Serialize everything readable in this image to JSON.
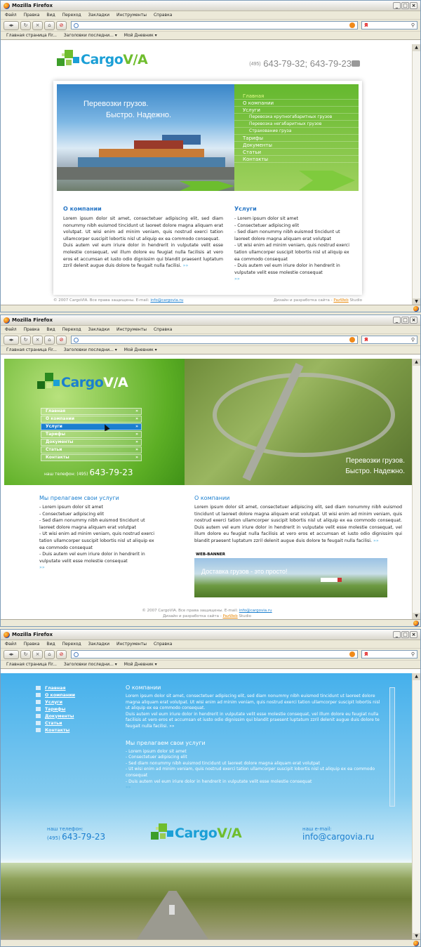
{
  "browser": {
    "title": "Mozilla Firefox",
    "menu": [
      "Файл",
      "Правка",
      "Вид",
      "Переход",
      "Закладки",
      "Инструменты",
      "Справка"
    ],
    "bookmarks": [
      "Главная страница Fir...",
      "Заголовки последни... ▾",
      "Мой Дневник ▾"
    ],
    "search_engine": "Я"
  },
  "brand": {
    "cargo": "Cargo",
    "via": "V/A"
  },
  "page1": {
    "phone_code": "(495)",
    "phone_numbers": "643-79-32; 643-79-23",
    "hero_line1": "Перевозки грузов.",
    "hero_line2": "Быстро. Надежно.",
    "menu": [
      {
        "label": "Главная",
        "type": "main",
        "active": true
      },
      {
        "label": "О компании",
        "type": "main"
      },
      {
        "label": "Услуги",
        "type": "main"
      },
      {
        "label": "Перевозка крупногабаритных грузов",
        "type": "sub"
      },
      {
        "label": "Перевозка негабаритных грузов",
        "type": "sub"
      },
      {
        "label": "Страхование груза",
        "type": "sub"
      },
      {
        "label": "Тарифы",
        "type": "main"
      },
      {
        "label": "Документы",
        "type": "main"
      },
      {
        "label": "Статьи",
        "type": "main"
      },
      {
        "label": "Контакты",
        "type": "main"
      }
    ],
    "about_title": "О компании",
    "about_p1": "Lorem ipsum dolor sit amet, consectetuer adipiscing elit, sed diam nonummy nibh euismod tincidunt ut laoreet dolore magna aliquam erat volutpat. Ut wisi enim ad minim veniam, quis nostrud exerci tation ullamcorper suscipit lobortis nisl ut aliquip ex ea commodo consequat.",
    "about_p2": "Duis autem vel eum iriure dolor in hendrerit in vulputate velit esse molestie consequat, vel illum dolore eu feugiat nulla facilisis at vero eros et accumsan et iusto odio dignissim qui blandit praesent luptatum zzril delenit augue duis dolore te feugait nulla facilisi.",
    "more": "»»",
    "services_title": "Услуги",
    "services": [
      "- Lorem ipsum dolor sit amet",
      "- Consectetuer adipiscing elit",
      "- Sed diam nonummy nibh euismod tincidunt ut laoreet dolore magna aliquam erat volutpat",
      "- Ut wisi enim ad minim veniam, quis nostrud exerci tation ullamcorper suscipit lobortis nisl ut aliquip ex ea commodo consequat",
      "- Duis autem vel eum iriure dolor in hendrerit in vulputate velit esse molestie consequat"
    ],
    "footer_left": "© 2007 CargoVIA. Все права защищены. E-mail:",
    "email": "info@cargovia.ru",
    "footer_right_pre": "Дизайн и разработка сайта -",
    "studio_name": "PazWeb",
    "studio_suffix": "Studio"
  },
  "page2": {
    "menu": [
      "Главная",
      "О компании",
      "Услуги",
      "Тарифы",
      "Документы",
      "Статьи",
      "Контакты"
    ],
    "menu_arrow": "»",
    "phone_label": "наш телефон:",
    "phone_code": "(495)",
    "phone": "643-79-23",
    "hero_line1": "Перевозки грузов.",
    "hero_line2": "Быстро. Надежно.",
    "services_title": "Мы прелагаем свои услуги",
    "services": [
      "- Lorem ipsum dolor sit amet",
      "- Consectetuer adipiscing elit",
      "- Sed diam nonummy nibh euismod tincidunt ut laoreet dolore magna aliquam erat volutpat",
      "- Ut wisi enim ad minim veniam, quis nostrud exerci tation ullamcorper suscipit lobortis nisl ut aliquip ex ea commodo consequat",
      "- Duis autem vel eum iriure dolor in hendrerit in vulputate velit esse molestie consequat"
    ],
    "about_title": "О компании",
    "about_text": "Lorem ipsum dolor sit amet, consectetuer adipiscing elit, sed diam nonummy nibh euismod tincidunt ut laoreet dolore magna aliquam erat volutpat. Ut wisi enim ad minim veniam, quis nostrud exerci tation ullamcorper suscipit lobortis nisl ut aliquip ex ea commodo consequat. Duis autem vel eum iriure dolor in hendrerit in vulputate velit esse molestie consequat, vel illum dolore eu feugiat nulla facilisis at vero eros et accumsan et iusto odio dignissim qui blandit praesent luptatum zzril delenit augue duis dolore te feugait nulla facilisi.",
    "banner_label": "WEB-BANNER",
    "banner_text": "Доставка грузов - это просто!",
    "footer_line1": "© 2007 CargoVIA. Все права защищены. E-mail:",
    "footer_line2": "Дизайн и разработка сайта -"
  },
  "page3": {
    "menu": [
      "Главная",
      "О компании",
      "Услуги",
      "Тарифы",
      "Документы",
      "Статьи",
      "Контакты"
    ],
    "about_title": "О компании",
    "about_p1": "Lorem ipsum dolor sit amet, consectetuer adipiscing elit, sed diam nonummy nibh euismod tincidunt ut laoreet dolore magna aliquam erat volutpat. Ut wisi enim ad minim veniam, quis nostrud exerci tation ullamcorper suscipit lobortis nisl ut aliquip ex ea commodo consequat.",
    "about_p2": "Duis autem vel eum iriure dolor in hendrerit in vulputate velit esse molestie consequat, vel illum dolore eu feugiat nulla facilisis at vero eros et accumsan et iusto odio dignissim qui blandit praesent luptatum zzril delenit augue duis dolore te feugait nulla facilisi.",
    "services_title": "Мы прелагаем свои услуги",
    "services": [
      "- Lorem ipsum dolor sit amet",
      "- Consectetuer adipiscing elit",
      "- Sed diam nonummy nibh euismod tincidunt ut laoreet dolore magna aliquam erat volutpat",
      "- Ut wisi enim ad minim veniam, quis nostrud exerci tation ullamcorper suscipit lobortis nisl ut aliquip ex ea commodo consequat",
      "- Duis autem vel eum iriure dolor in hendrerit in vulputate velit esse molestie consequat"
    ],
    "phone_label": "наш телефон:",
    "phone_code": "(495)",
    "phone": "643-79-23",
    "email_label": "наш e-mail:"
  },
  "colors": {
    "brand_blue": "#1b9fd6",
    "brand_green": "#6fbd2e"
  }
}
